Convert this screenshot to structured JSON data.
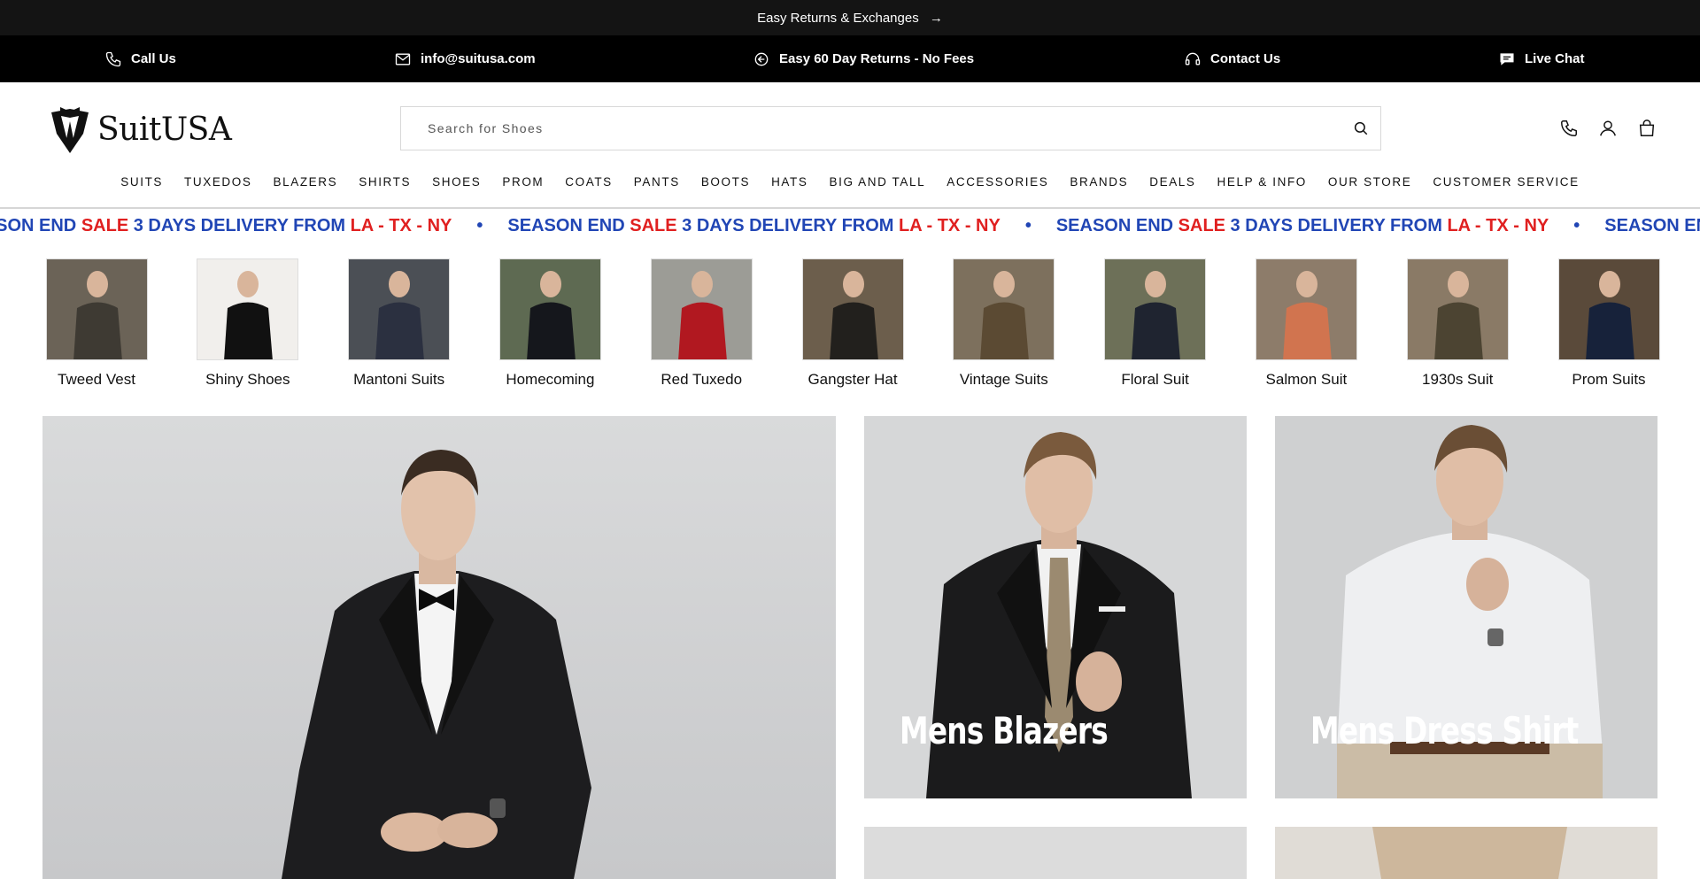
{
  "announcement": {
    "text": "Easy Returns & Exchanges",
    "arrow": "→"
  },
  "utility_bar": {
    "items": [
      {
        "label": "Call Us",
        "icon": "phone-icon"
      },
      {
        "label": "info@suitusa.com",
        "icon": "mail-icon"
      },
      {
        "label": "Easy 60 Day Returns - No Fees",
        "icon": "returns-icon"
      },
      {
        "label": "Contact Us",
        "icon": "headset-icon"
      },
      {
        "label": "Live Chat",
        "icon": "chat-icon"
      }
    ]
  },
  "header": {
    "logo_text": "SuitUSA",
    "search_placeholder": "Search for Shoes"
  },
  "nav": {
    "items": [
      "SUITS",
      "TUXEDOS",
      "BLAZERS",
      "SHIRTS",
      "SHOES",
      "PROM",
      "COATS",
      "PANTS",
      "BOOTS",
      "HATS",
      "BIG AND TALL",
      "ACCESSORIES",
      "BRANDS",
      "DEALS",
      "HELP & INFO",
      "OUR STORE",
      "CUSTOMER SERVICE"
    ]
  },
  "marquee": {
    "part1": "SEASON END ",
    "part2": "SALE",
    "part3": " 3 DAYS DELIVERY FROM ",
    "part4": "LA - TX - NY",
    "separator": "•",
    "colors": {
      "blue": "#2146b5",
      "red": "#e02020"
    }
  },
  "categories": [
    {
      "label": "Tweed Vest"
    },
    {
      "label": "Shiny Shoes"
    },
    {
      "label": "Mantoni Suits"
    },
    {
      "label": "Homecoming"
    },
    {
      "label": "Red Tuxedo"
    },
    {
      "label": "Gangster Hat"
    },
    {
      "label": "Vintage Suits"
    },
    {
      "label": "Floral Suit"
    },
    {
      "label": "Salmon Suit"
    },
    {
      "label": "1930s Suit"
    },
    {
      "label": "Prom Suits"
    }
  ],
  "tiles": {
    "blazers": {
      "title": "Mens Blazers"
    },
    "dress_shirt": {
      "title": "Mens Dress Shirt"
    }
  }
}
